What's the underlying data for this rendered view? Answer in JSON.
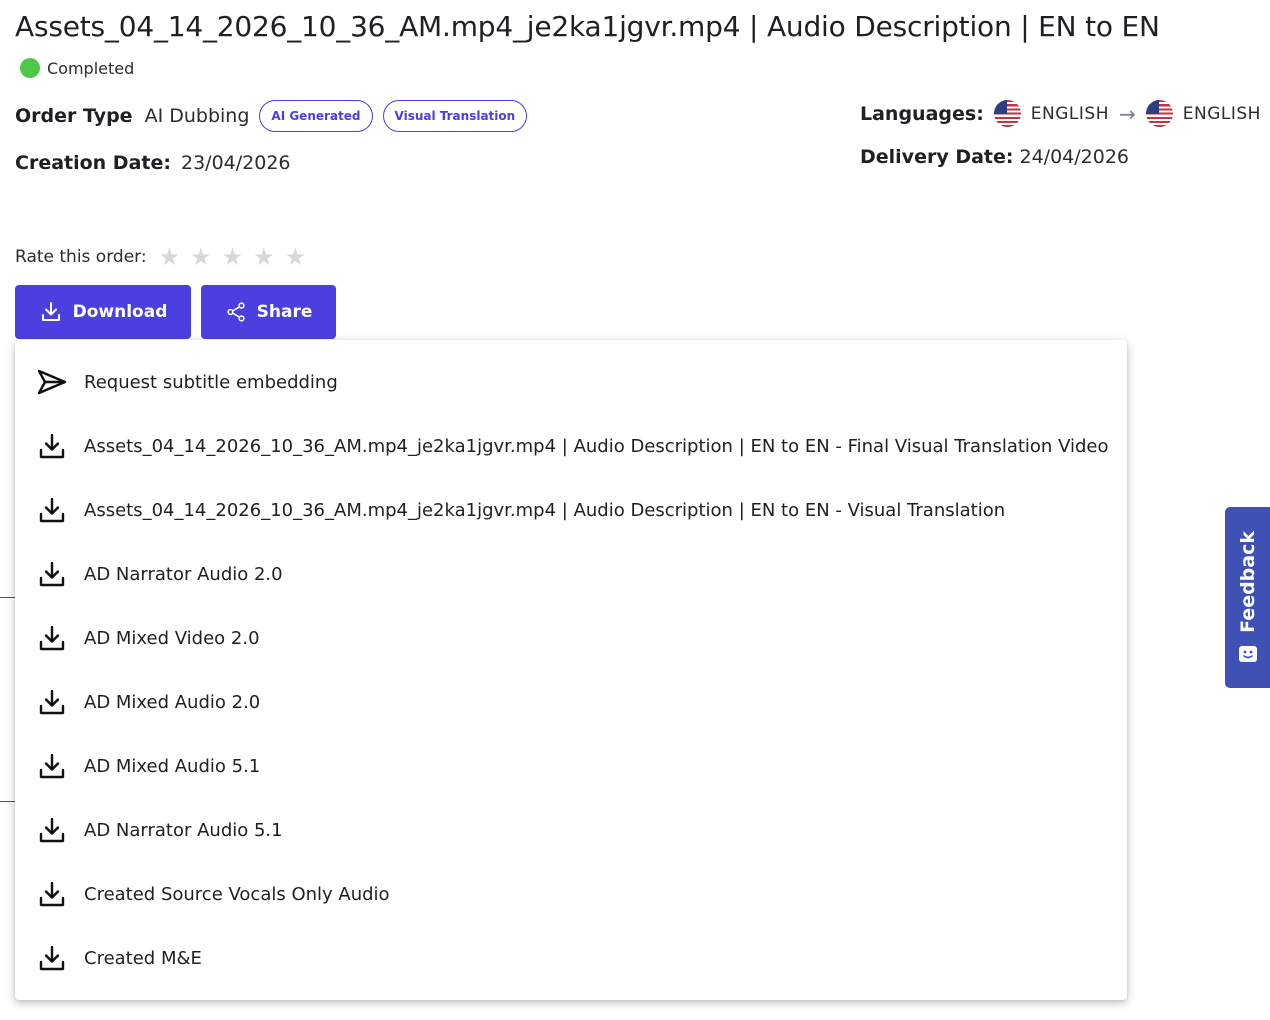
{
  "page": {
    "title": "Assets_04_14_2026_10_36_AM.mp4_je2ka1jgvr.mp4 | Audio Description | EN to EN",
    "status": {
      "label": "Completed",
      "color": "#4fc84a"
    }
  },
  "details": {
    "order_type_label": "Order Type",
    "order_type_value": "AI Dubbing",
    "tags": [
      "AI Generated",
      "Visual Translation"
    ],
    "creation_date_label": "Creation Date:",
    "creation_date_value": "23/04/2026",
    "languages_label": "Languages:",
    "source_language": "ENGLISH",
    "target_language": "ENGLISH",
    "delivery_date_label": "Delivery Date:",
    "delivery_date_value": "24/04/2026"
  },
  "rating": {
    "label": "Rate this order:",
    "stars_total": 5,
    "stars_filled": 0
  },
  "actions": {
    "download_label": "Download",
    "share_label": "Share"
  },
  "download_menu": {
    "items": [
      {
        "label": "Request subtitle embedding",
        "icon": "send-icon"
      },
      {
        "label": "Assets_04_14_2026_10_36_AM.mp4_je2ka1jgvr.mp4 | Audio Description | EN to EN - Final Visual Translation Video",
        "icon": "download-icon"
      },
      {
        "label": "Assets_04_14_2026_10_36_AM.mp4_je2ka1jgvr.mp4 | Audio Description | EN to EN - Visual Translation",
        "icon": "download-icon"
      },
      {
        "label": "AD Narrator Audio 2.0",
        "icon": "download-icon"
      },
      {
        "label": "AD Mixed Video 2.0",
        "icon": "download-icon"
      },
      {
        "label": "AD Mixed Audio 2.0",
        "icon": "download-icon"
      },
      {
        "label": "AD Mixed Audio 5.1",
        "icon": "download-icon"
      },
      {
        "label": "AD Narrator Audio 5.1",
        "icon": "download-icon"
      },
      {
        "label": "Created Source Vocals Only Audio",
        "icon": "download-icon"
      },
      {
        "label": "Created M&E",
        "icon": "download-icon"
      }
    ]
  },
  "feedback": {
    "label": "Feedback"
  },
  "colors": {
    "accent": "#4c3fe0",
    "feedback_tab": "#3f51b5",
    "star_empty": "#d8d8dc"
  }
}
